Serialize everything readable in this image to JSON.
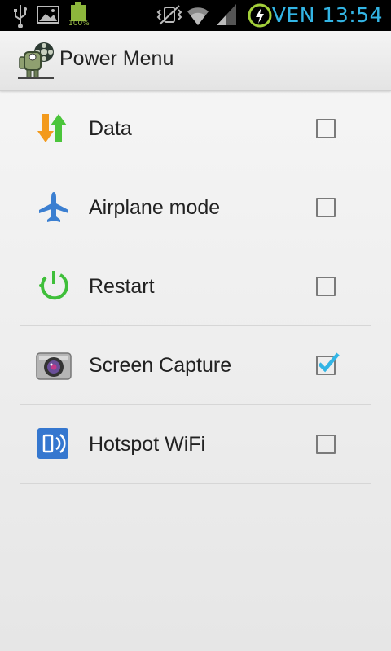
{
  "status_bar": {
    "time": "VEN 13:54",
    "battery_text": "100%",
    "accent_color": "#33b5e5",
    "icons": [
      "usb-icon",
      "image-icon",
      "battery-icon",
      "vibrate-icon",
      "wifi-icon",
      "signal-icon",
      "power-saver-icon"
    ]
  },
  "action_bar": {
    "title": "Power Menu",
    "icon": "app-robot-icon"
  },
  "list": {
    "items": [
      {
        "label": "Data",
        "icon": "data-arrows-icon",
        "checked": false
      },
      {
        "label": "Airplane mode",
        "icon": "airplane-icon",
        "checked": false
      },
      {
        "label": "Restart",
        "icon": "restart-icon",
        "checked": false
      },
      {
        "label": "Screen Capture",
        "icon": "camera-icon",
        "checked": true
      },
      {
        "label": "Hotspot WiFi",
        "icon": "hotspot-icon",
        "checked": false
      }
    ]
  },
  "colors": {
    "check_mark": "#33b5e5",
    "text": "#222222",
    "divider": "#d6d6d6"
  }
}
